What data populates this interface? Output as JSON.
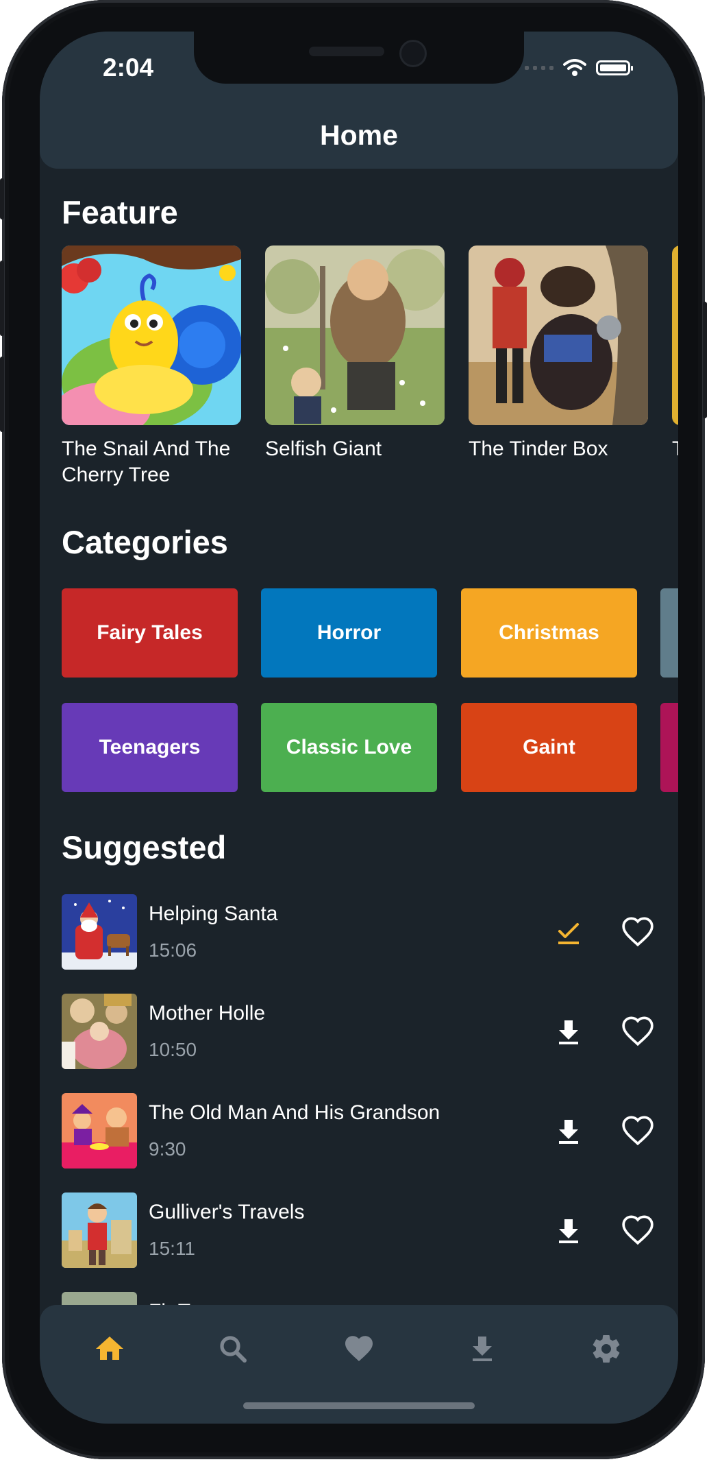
{
  "status_bar": {
    "time": "2:04"
  },
  "app_bar": {
    "title": "Home"
  },
  "sections": {
    "feature": "Feature",
    "categories": "Categories",
    "suggested": "Suggested"
  },
  "featured": [
    {
      "title": "The Snail And The Cherry Tree"
    },
    {
      "title": "Selfish Giant"
    },
    {
      "title": "The Tinder Box"
    },
    {
      "title": "T"
    }
  ],
  "categories": [
    {
      "label": "Fairy Tales",
      "color": "#c62828"
    },
    {
      "label": "Horror",
      "color": "#0277bd"
    },
    {
      "label": "Christmas",
      "color": "#f5a623"
    },
    {
      "label": "",
      "color": "#607d8b"
    },
    {
      "label": "Teenagers",
      "color": "#673ab7"
    },
    {
      "label": "Classic Love",
      "color": "#4caf50"
    },
    {
      "label": "Gaint",
      "color": "#d84315"
    },
    {
      "label": "",
      "color": "#ad1457"
    }
  ],
  "suggested": [
    {
      "title": "Helping Santa",
      "duration": "15:06",
      "status_icon": "downloaded-check-icon"
    },
    {
      "title": "Mother Holle",
      "duration": "10:50",
      "status_icon": "download-icon"
    },
    {
      "title": "The Old Man And His Grandson",
      "duration": "9:30",
      "status_icon": "download-icon"
    },
    {
      "title": "Gulliver's Travels",
      "duration": "15:11",
      "status_icon": "download-icon"
    },
    {
      "title": "Fir Tr",
      "duration": "",
      "status_icon": ""
    }
  ],
  "bottom_nav": [
    {
      "icon": "home-icon",
      "active": true
    },
    {
      "icon": "search-icon",
      "active": false
    },
    {
      "icon": "heart-icon",
      "active": false
    },
    {
      "icon": "download-icon",
      "active": false
    },
    {
      "icon": "gear-icon",
      "active": false
    }
  ],
  "colors": {
    "accent": "#f5b531",
    "app_bar": "#273540",
    "background": "#1b232a"
  }
}
